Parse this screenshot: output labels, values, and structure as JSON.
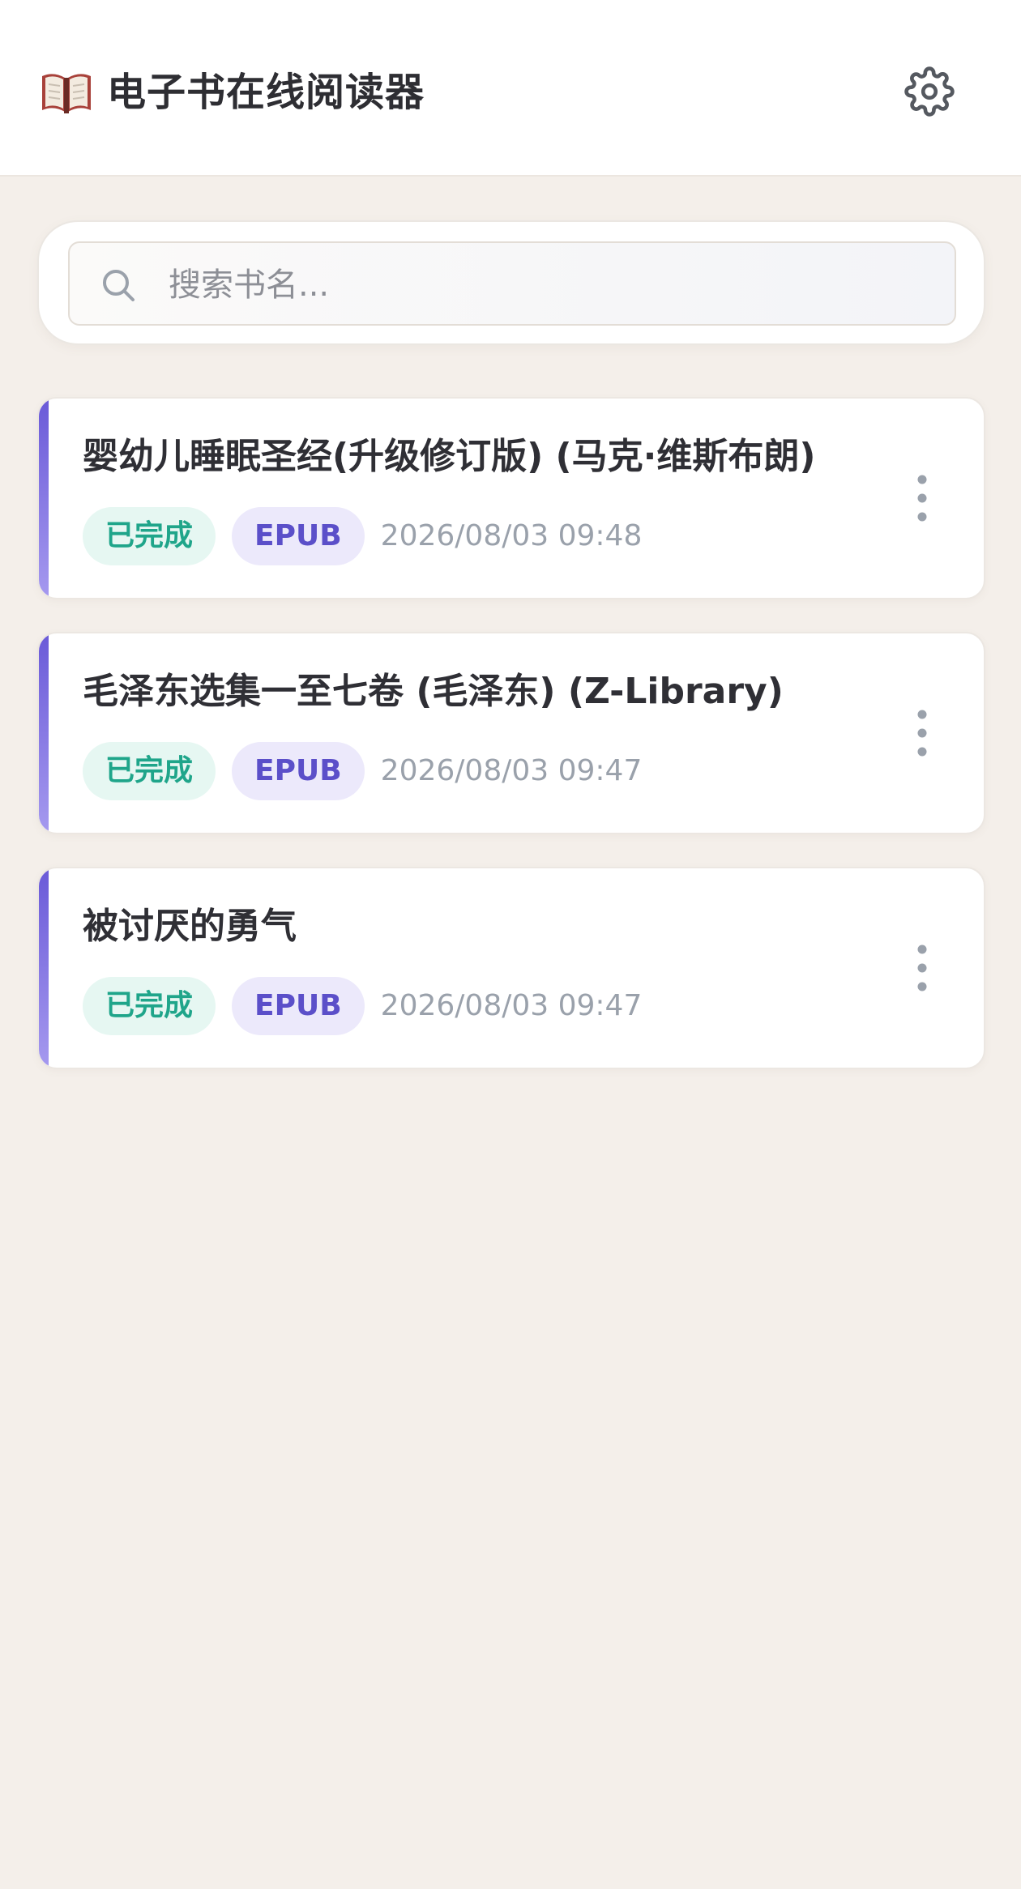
{
  "header": {
    "logo_icon": "open-book-icon",
    "title": "电子书在线阅读器",
    "settings_icon": "gear-icon"
  },
  "search": {
    "icon": "search-icon",
    "placeholder": "搜索书名...",
    "value": ""
  },
  "books": [
    {
      "title": "婴幼儿睡眠圣经(升级修订版) (马克·维斯布朗)",
      "status": "已完成",
      "format": "EPUB",
      "date": "2026/08/03 09:48",
      "more_icon": "more-vertical-icon"
    },
    {
      "title": "毛泽东选集一至七卷 (毛泽东) (Z-Library)",
      "status": "已完成",
      "format": "EPUB",
      "date": "2026/08/03 09:47",
      "more_icon": "more-vertical-icon"
    },
    {
      "title": "被讨厌的勇气",
      "status": "已完成",
      "format": "EPUB",
      "date": "2026/08/03 09:47",
      "more_icon": "more-vertical-icon"
    }
  ],
  "colors": {
    "accent": "#6a5ad8",
    "status_green": "#1fa58a",
    "format_purple": "#5b4fc9",
    "background": "#f4efea"
  }
}
